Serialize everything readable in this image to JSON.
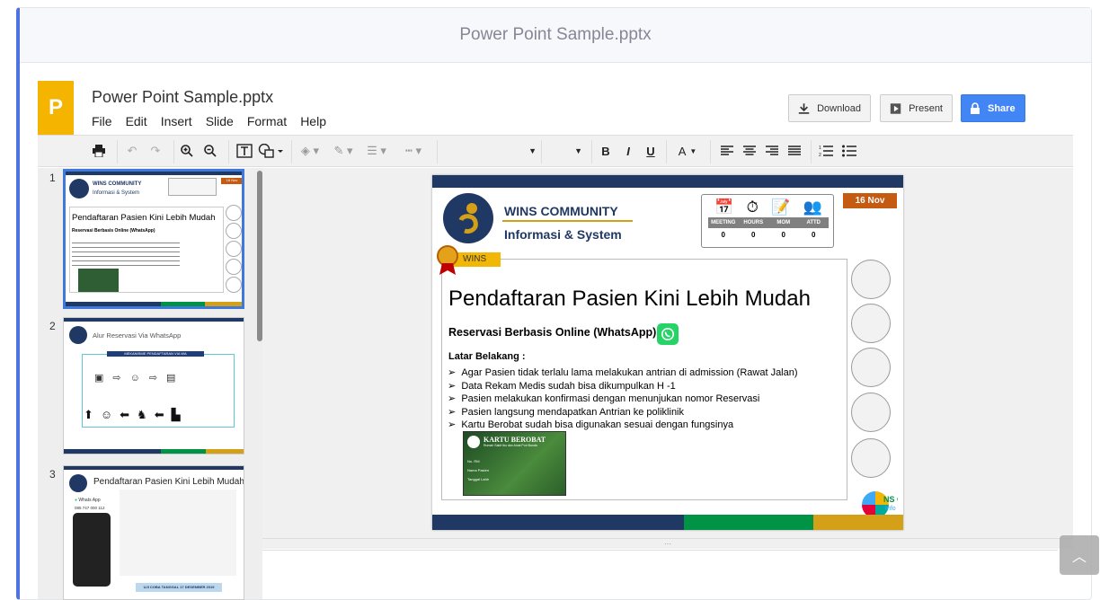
{
  "card_header_title": "Power Point Sample.pptx",
  "app": {
    "logo_letter": "P",
    "doc_title": "Power Point Sample.pptx",
    "menu": [
      "File",
      "Edit",
      "Insert",
      "Slide",
      "Format",
      "Help"
    ],
    "buttons": {
      "download": "Download",
      "present": "Present",
      "share": "Share"
    }
  },
  "slide_numbers": [
    "1",
    "2",
    "3"
  ],
  "thumbnails": {
    "t1": {
      "brand1": "WINS COMMUNITY",
      "brand2": "Informasi & System",
      "title": "Pendaftaran Pasien Kini Lebih Mudah",
      "subtitle": "Reservasi Berbasis Online (WhatsApp)",
      "tag": "16 Nov"
    },
    "t2": {
      "title": "Alur Reservasi Via WhatsApp",
      "banner": "MEKANISME PENDAFTARAN VIA WA"
    },
    "t3": {
      "title": "Pendaftaran Pasien Kini Lebih Mudah",
      "wa": "Whats App",
      "phone": "085 747 000 112",
      "footer": "UJI COBA TANGGAL 17 DESEMBER 2019"
    }
  },
  "slide": {
    "brand_line1": "WINS COMMUNITY",
    "brand_line2": "Informasi & System",
    "date_tag": "16 Nov",
    "stats": [
      {
        "label": "MEETING",
        "value": "0"
      },
      {
        "label": "HOURS",
        "value": "0"
      },
      {
        "label": "MOM",
        "value": "0"
      },
      {
        "label": "ATTD",
        "value": "0"
      }
    ],
    "ribbon": "WINS",
    "title": "Pendaftaran Pasien Kini Lebih Mudah",
    "subtitle": "Reservasi Berbasis Online (WhatsApp)",
    "section": "Latar Belakang :",
    "bullets": [
      "Agar Pasien tidak terlalu lama melakukan antrian di admission (Rawat Jalan)",
      "Data Rekam Medis sudah bisa dikumpulkan H -1",
      "Pasien melakukan konfirmasi dengan menunjukan nomor Reservasi",
      "Pasien langsung mendapatkan Antrian ke poliklinik",
      "Kartu Berobat sudah bisa digunakan sesuai dengan fungsinya"
    ],
    "card_title": "KARTU BEROBAT",
    "card_sub": "Rumah Sakit Ibu dan Anak Puri Bunda",
    "card_fields": [
      "No. RM",
      "Nama Pasien",
      "Tanggal Lahir"
    ],
    "corner_logo_text": "NS C",
    "corner_logo_sub": "Info"
  },
  "colors": {
    "accent": "#4e73df",
    "navy": "#203864",
    "green": "#009245",
    "gold": "#d4a017",
    "orange": "#c55a11",
    "share": "#4285f4",
    "logo": "#f4b400"
  }
}
